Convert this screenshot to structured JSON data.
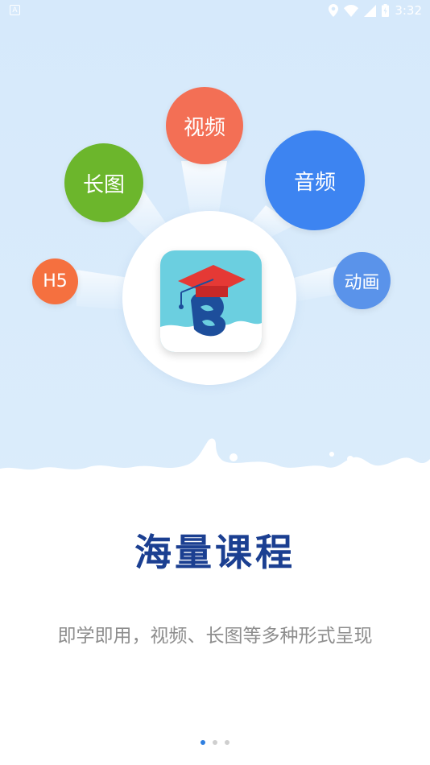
{
  "status_bar": {
    "time": "3:32",
    "left_icon": "A",
    "icons": [
      "location-icon",
      "wifi-icon",
      "signal-icon",
      "battery-icon"
    ]
  },
  "bubbles": {
    "video": "视频",
    "long_image": "长图",
    "audio": "音频",
    "h5": "H5",
    "animation": "动画"
  },
  "colors": {
    "video": "#f36f55",
    "long_image": "#6cb62c",
    "audio": "#3d84f1",
    "h5": "#f5703f",
    "animation": "#5a93ea",
    "headline": "#1b3f91",
    "active_dot": "#2f7fe0"
  },
  "main": {
    "title": "海量课程",
    "subtitle": "即学即用，视频、长图等多种形式呈现"
  },
  "pager": {
    "count": 3,
    "active_index": 0
  }
}
